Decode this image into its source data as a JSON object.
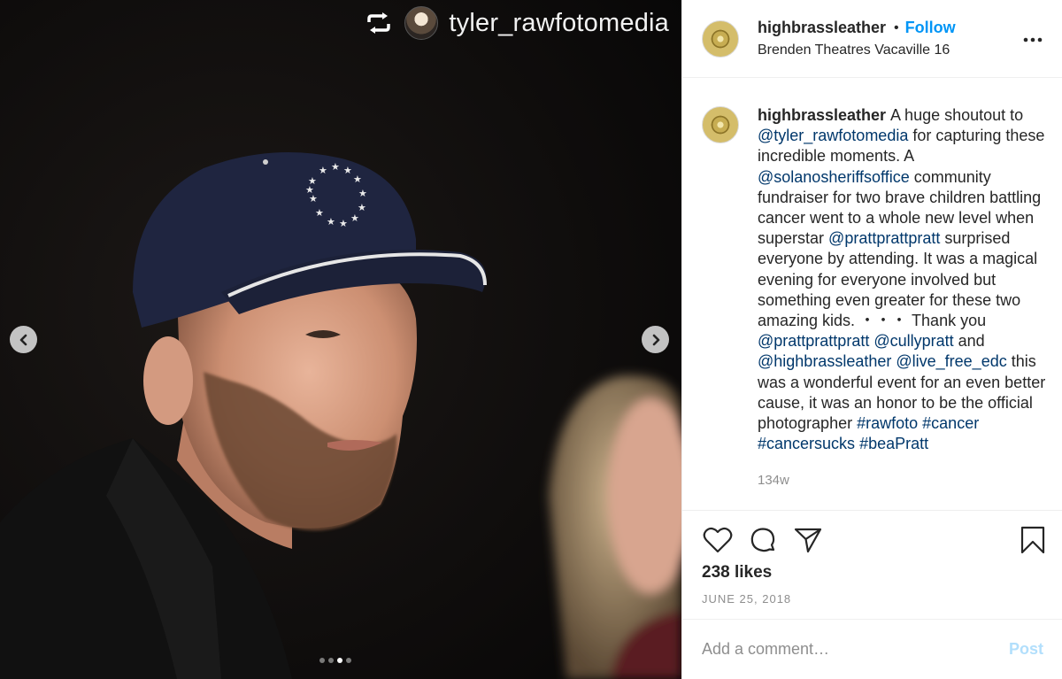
{
  "repost": {
    "username": "tyler_rawfotomedia",
    "repost_icon": "repost-icon"
  },
  "carousel": {
    "slide_count": 4,
    "active_index": 2,
    "prev_icon": "chevron-left-icon",
    "next_icon": "chevron-right-icon"
  },
  "header": {
    "username": "highbrassleather",
    "separator": "•",
    "follow_label": "Follow",
    "location": "Brenden Theatres Vacaville 16",
    "more_icon": "more-options-icon"
  },
  "caption": {
    "username": "highbrassleather",
    "segments": [
      {
        "type": "text",
        "text": "A huge shoutout to "
      },
      {
        "type": "link",
        "text": "@tyler_rawfotomedia"
      },
      {
        "type": "text",
        "text": " for capturing these incredible moments. A "
      },
      {
        "type": "link",
        "text": "@solanosheriffsoffice"
      },
      {
        "type": "text",
        "text": " community fundraiser for two brave children battling cancer went to a whole new level when superstar "
      },
      {
        "type": "link",
        "text": "@prattprattpratt"
      },
      {
        "type": "text",
        "text": " surprised everyone by attending. It was a magical evening for everyone involved but something even greater for these two amazing kids. ・・・ Thank you "
      },
      {
        "type": "link",
        "text": "@prattprattpratt"
      },
      {
        "type": "text",
        "text": " "
      },
      {
        "type": "link",
        "text": "@cullypratt"
      },
      {
        "type": "text",
        "text": " and "
      },
      {
        "type": "link",
        "text": "@highbrassleather"
      },
      {
        "type": "text",
        "text": " "
      },
      {
        "type": "link",
        "text": "@live_free_edc"
      },
      {
        "type": "text",
        "text": " this was a wonderful event for an even better cause, it was an honor to be the official photographer "
      },
      {
        "type": "link",
        "text": "#rawfoto"
      },
      {
        "type": "text",
        "text": " "
      },
      {
        "type": "link",
        "text": "#cancer"
      },
      {
        "type": "text",
        "text": " "
      },
      {
        "type": "link",
        "text": "#cancersucks"
      },
      {
        "type": "text",
        "text": " "
      },
      {
        "type": "link",
        "text": "#beaPratt"
      }
    ],
    "age": "134w"
  },
  "actions": {
    "like_icon": "heart-icon",
    "comment_icon": "comment-icon",
    "share_icon": "send-icon",
    "save_icon": "bookmark-icon"
  },
  "likes": "238 likes",
  "date": "JUNE 25, 2018",
  "comment": {
    "placeholder": "Add a comment…",
    "post_label": "Post"
  },
  "colors": {
    "link": "#00376b",
    "follow": "#0095f6",
    "post_disabled": "#b2dffc",
    "muted": "#8e8e8e"
  }
}
